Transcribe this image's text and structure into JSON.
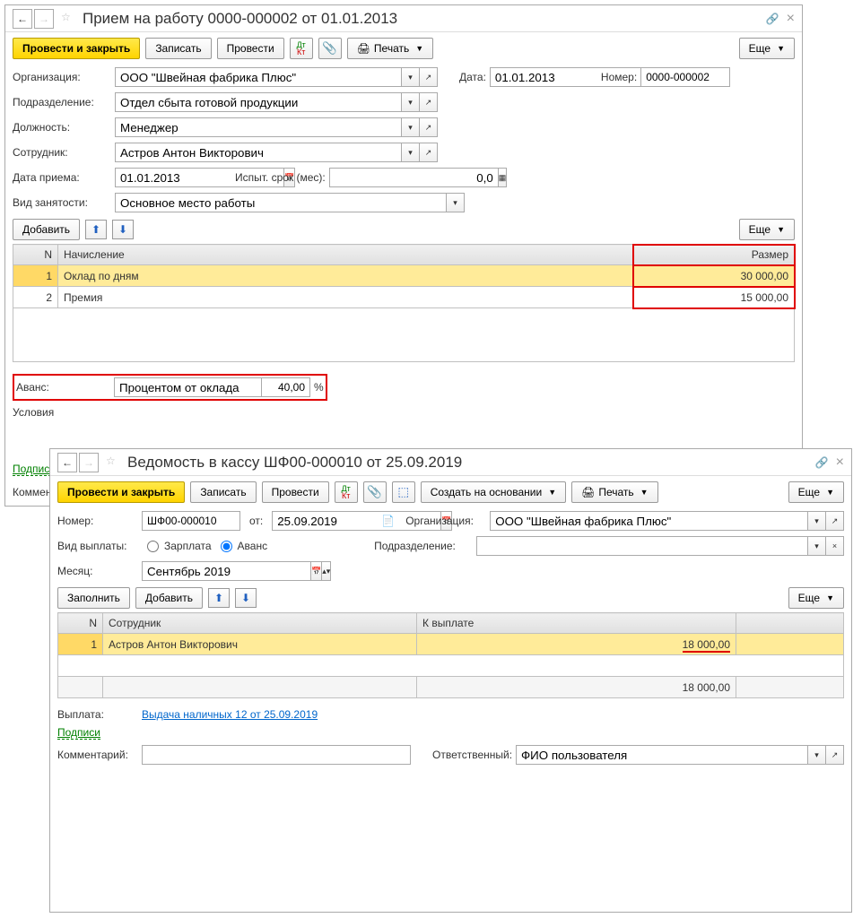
{
  "window1": {
    "title": "Прием на работу 0000-000002 от 01.01.2013",
    "toolbar": {
      "submit_close": "Провести и закрыть",
      "write": "Записать",
      "submit": "Провести",
      "print": "Печать",
      "more": "Еще"
    },
    "labels": {
      "org": "Организация:",
      "date": "Дата:",
      "number": "Номер:",
      "dept": "Подразделение:",
      "position": "Должность:",
      "employee": "Сотрудник:",
      "hire_date": "Дата приема:",
      "probation": "Испыт. срок (мес):",
      "employment": "Вид занятости:",
      "advance": "Аванс:",
      "conditions": "Условия"
    },
    "values": {
      "org": "ООО \"Швейная фабрика Плюс\"",
      "date": "01.01.2013",
      "number": "0000-000002",
      "dept": "Отдел сбыта готовой продукции",
      "position": "Менеджер",
      "employee": "Астров Антон Викторович",
      "hire_date": "01.01.2013",
      "probation": "0,0",
      "employment": "Основное место работы",
      "advance_type": "Процентом от оклада",
      "advance_value": "40,00",
      "advance_pct": "%"
    },
    "table_toolbar": {
      "add": "Добавить",
      "more": "Еще"
    },
    "table": {
      "cols": {
        "n": "N",
        "accrual": "Начисление",
        "size": "Размер"
      },
      "rows": [
        {
          "n": "1",
          "accrual": "Оклад по дням",
          "size": "30 000,00"
        },
        {
          "n": "2",
          "accrual": "Премия",
          "size": "15 000,00"
        }
      ]
    },
    "links": {
      "signatures": "Подписи"
    },
    "comment_label": "Коммент"
  },
  "window2": {
    "title": "Ведомость в кассу ШФ00-000010 от 25.09.2019",
    "toolbar": {
      "submit_close": "Провести и закрыть",
      "write": "Записать",
      "submit": "Провести",
      "create_based": "Создать на основании",
      "print": "Печать",
      "more": "Еще"
    },
    "labels": {
      "number": "Номер:",
      "from": "от:",
      "org": "Организация:",
      "payment_type": "Вид выплаты:",
      "dept": "Подразделение:",
      "month": "Месяц:",
      "payout": "Выплата:",
      "comment": "Комментарий:",
      "responsible": "Ответственный:"
    },
    "values": {
      "number": "ШФ00-000010",
      "from": "25.09.2019",
      "org": "ООО \"Швейная фабрика Плюс\"",
      "month": "Сентябрь 2019",
      "responsible": "ФИО пользователя"
    },
    "radio": {
      "salary": "Зарплата",
      "advance": "Аванс"
    },
    "table_toolbar": {
      "fill": "Заполнить",
      "add": "Добавить",
      "more": "Еще"
    },
    "table": {
      "cols": {
        "n": "N",
        "employee": "Сотрудник",
        "payout": "К выплате"
      },
      "rows": [
        {
          "n": "1",
          "employee": "Астров Антон Викторович",
          "payout": "18 000,00"
        }
      ],
      "footer_payout": "18 000,00"
    },
    "links": {
      "payout": "Выдача наличных 12 от 25.09.2019",
      "signatures": "Подписи"
    }
  }
}
